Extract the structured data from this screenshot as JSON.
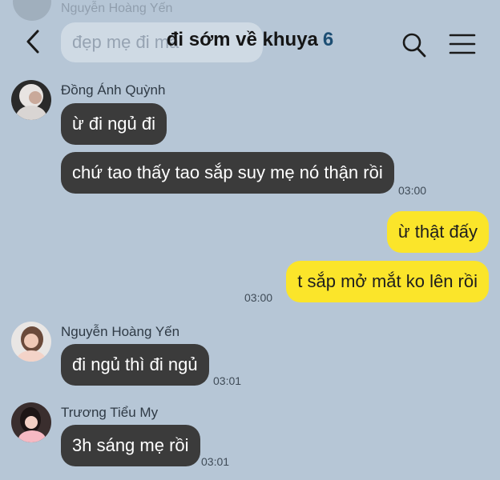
{
  "ghost": {
    "sender": "Nguyễn Hoàng Yến",
    "text": "đẹp mẹ đi mà"
  },
  "header": {
    "back_icon": "chevron-left-icon",
    "title": "đi sớm về khuya",
    "member_count": "6",
    "search_icon": "search-icon",
    "menu_icon": "hamburger-menu-icon"
  },
  "messages": [
    {
      "sender": "Đồng Ánh Quỳnh",
      "bubbles": [
        "ừ đi ngủ đi",
        "chứ tao thấy tao sắp suy mẹ nó thận rồi"
      ],
      "time": "03:00"
    },
    {
      "mine": true,
      "bubbles": [
        "ừ thật đấy",
        "t sắp mở mắt ko lên rồi"
      ],
      "time": "03:00"
    },
    {
      "sender": "Nguyễn Hoàng Yến",
      "bubbles": [
        "đi ngủ thì đi ngủ"
      ],
      "time": "03:01"
    },
    {
      "sender": "Trương Tiểu My",
      "bubbles": [
        "3h sáng mẹ rồi"
      ],
      "time": "03:01"
    }
  ],
  "colors": {
    "background": "#b6c6d6",
    "incoming_bubble": "#3b3b3b",
    "outgoing_bubble": "#fbe52a",
    "member_count": "#1d4e73"
  }
}
